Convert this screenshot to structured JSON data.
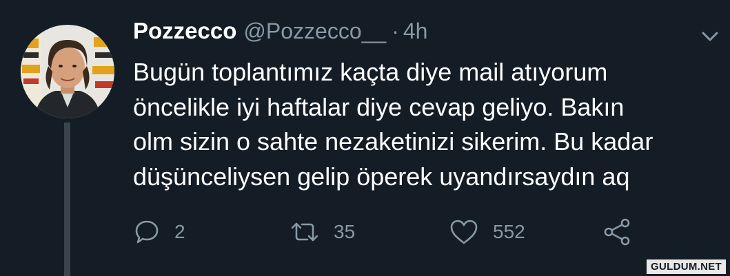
{
  "tweet": {
    "display_name": "Pozzecco",
    "handle": "@Pozzecco__",
    "separator": "·",
    "time": "4h",
    "text_lines": [
      "Bugün toplantımız kaçta diye mail atıyorum",
      "öncelikle iyi haftalar diye cevap geliyo. Bakın",
      "olm sizin o sahte nezaketinizi sikerim. Bu kadar",
      "düşünceliysen gelip öperek uyandırsaydın aq"
    ]
  },
  "actions": {
    "reply_count": "2",
    "retweet_count": "35",
    "like_count": "552"
  },
  "watermark": "GULDUM.NET",
  "icons": {
    "reply": "reply-icon",
    "retweet": "retweet-icon",
    "like": "heart-icon",
    "share": "share-icon",
    "menu": "chevron-down-icon"
  },
  "colors": {
    "background": "#141d26",
    "text": "#ffffff",
    "muted": "#8899a6",
    "thread_line": "#3a444d"
  }
}
